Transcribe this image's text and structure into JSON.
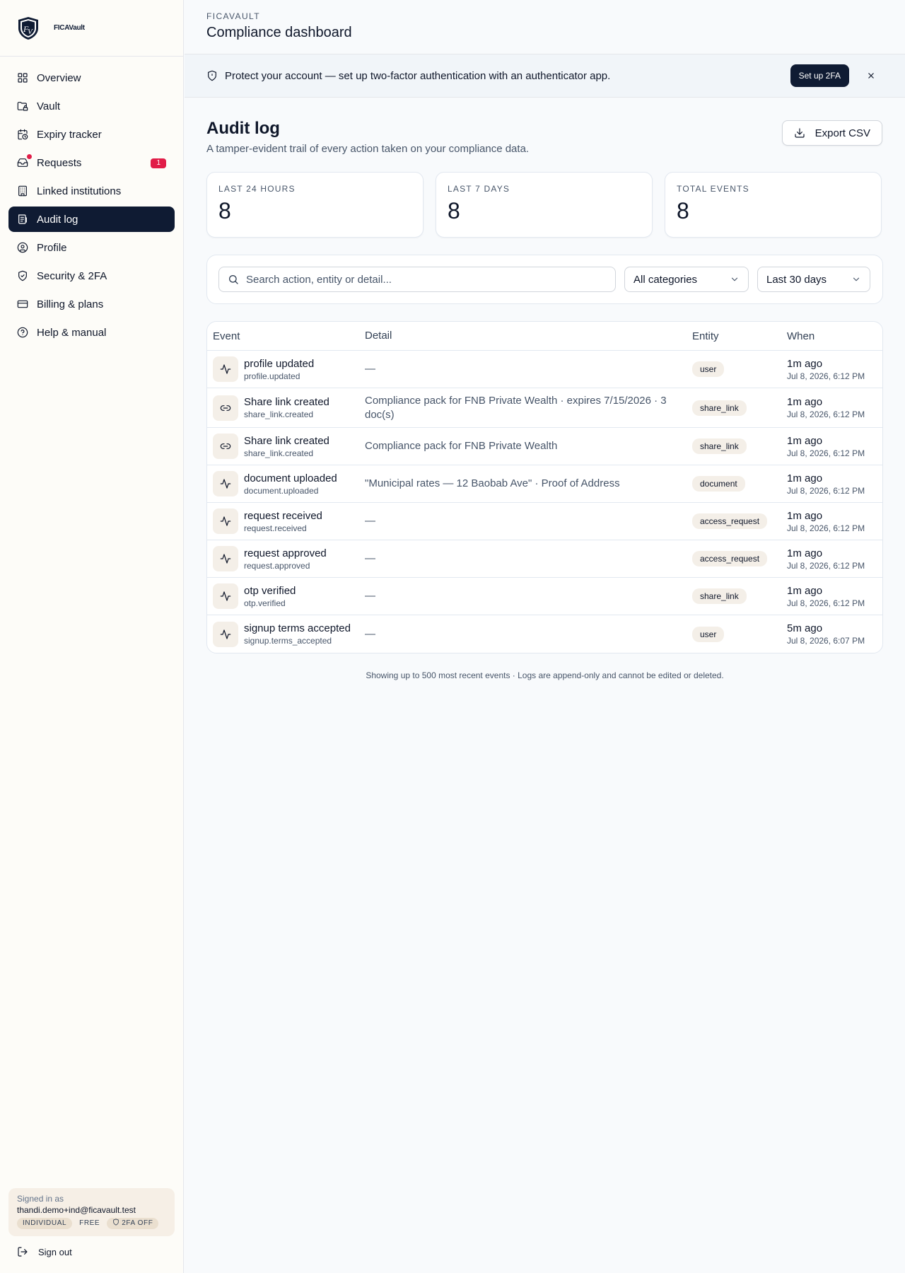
{
  "brand": {
    "name": "FICAVault"
  },
  "sidebar": {
    "items": [
      {
        "label": "Overview",
        "icon": "grid-icon"
      },
      {
        "label": "Vault",
        "icon": "folder-lock-icon"
      },
      {
        "label": "Expiry tracker",
        "icon": "calendar-clock-icon"
      },
      {
        "label": "Requests",
        "icon": "inbox-icon",
        "badge": "1"
      },
      {
        "label": "Linked institutions",
        "icon": "building-icon"
      },
      {
        "label": "Audit log",
        "icon": "log-icon",
        "active": true
      },
      {
        "label": "Profile",
        "icon": "user-circle-icon"
      },
      {
        "label": "Security & 2FA",
        "icon": "shield-check-icon"
      },
      {
        "label": "Billing & plans",
        "icon": "credit-card-icon"
      },
      {
        "label": "Help & manual",
        "icon": "help-circle-icon"
      }
    ],
    "user": {
      "signed_in_label": "Signed in as",
      "email": "thandi.demo+ind@ficavault.test",
      "tags": [
        "INDIVIDUAL",
        "FREE",
        "2FA OFF"
      ]
    },
    "sign_out": "Sign out"
  },
  "header": {
    "kicker": "FICAVAULT",
    "title": "Compliance dashboard"
  },
  "banner": {
    "text": "Protect your account — set up two-factor authentication with an authenticator app.",
    "button": "Set up 2FA"
  },
  "page": {
    "title": "Audit log",
    "subtitle": "A tamper-evident trail of every action taken on your compliance data.",
    "export_label": "Export CSV"
  },
  "stats": [
    {
      "label": "LAST 24 HOURS",
      "value": "8"
    },
    {
      "label": "LAST 7 DAYS",
      "value": "8"
    },
    {
      "label": "TOTAL EVENTS",
      "value": "8"
    }
  ],
  "filters": {
    "search_placeholder": "Search action, entity or detail...",
    "category": "All categories",
    "range": "Last 30 days"
  },
  "table": {
    "headers": {
      "event": "Event",
      "detail": "Detail",
      "entity": "Entity",
      "when": "When"
    },
    "rows": [
      {
        "icon": "activity-icon",
        "title": "profile updated",
        "code": "profile.updated",
        "detail": "—",
        "entity": "user",
        "rel": "1m ago",
        "abs": "Jul 8, 2026, 6:12 PM"
      },
      {
        "icon": "link-icon",
        "title": "Share link created",
        "code": "share_link.created",
        "detail": "Compliance pack for FNB Private Wealth · expires 7/15/2026 · 3 doc(s)",
        "entity": "share_link",
        "rel": "1m ago",
        "abs": "Jul 8, 2026, 6:12 PM"
      },
      {
        "icon": "link-icon",
        "title": "Share link created",
        "code": "share_link.created",
        "detail": "Compliance pack for FNB Private Wealth",
        "entity": "share_link",
        "rel": "1m ago",
        "abs": "Jul 8, 2026, 6:12 PM"
      },
      {
        "icon": "activity-icon",
        "title": "document uploaded",
        "code": "document.uploaded",
        "detail": "\"Municipal rates — 12 Baobab Ave\" · Proof of Address",
        "entity": "document",
        "rel": "1m ago",
        "abs": "Jul 8, 2026, 6:12 PM"
      },
      {
        "icon": "activity-icon",
        "title": "request received",
        "code": "request.received",
        "detail": "—",
        "entity": "access_request",
        "rel": "1m ago",
        "abs": "Jul 8, 2026, 6:12 PM"
      },
      {
        "icon": "activity-icon",
        "title": "request approved",
        "code": "request.approved",
        "detail": "—",
        "entity": "access_request",
        "rel": "1m ago",
        "abs": "Jul 8, 2026, 6:12 PM"
      },
      {
        "icon": "activity-icon",
        "title": "otp verified",
        "code": "otp.verified",
        "detail": "—",
        "entity": "share_link",
        "rel": "1m ago",
        "abs": "Jul 8, 2026, 6:12 PM"
      },
      {
        "icon": "activity-icon",
        "title": "signup terms accepted",
        "code": "signup.terms_accepted",
        "detail": "—",
        "entity": "user",
        "rel": "5m ago",
        "abs": "Jul 8, 2026, 6:07 PM"
      }
    ]
  },
  "footnote": "Showing up to 500 most recent events · Logs are append-only and cannot be edited or deleted."
}
